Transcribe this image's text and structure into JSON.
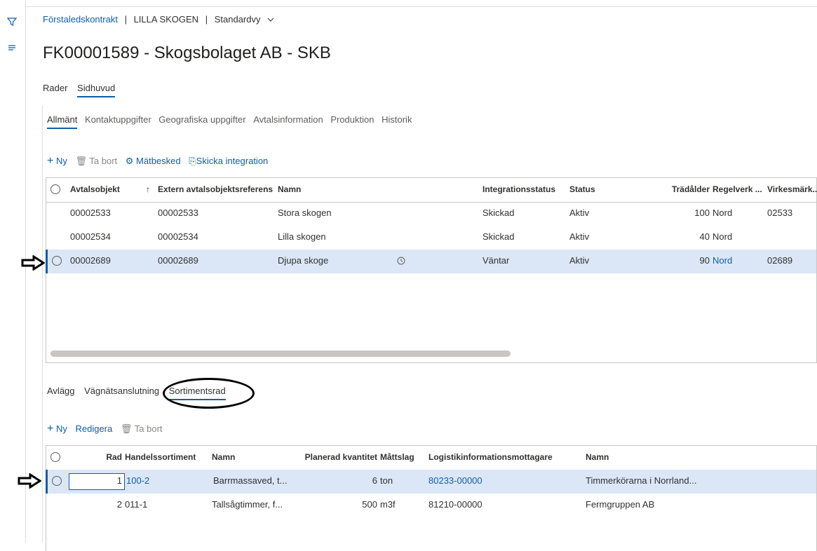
{
  "rail": {
    "filter_icon": "filter-icon",
    "menu_icon": "menu-icon"
  },
  "breadcrumb": {
    "crumb1": "Förstaledskontrakt",
    "sep1": "|",
    "crumb2": "LILLA SKOGEN",
    "sep2": "|",
    "view": "Standardvy",
    "view_icon": "chevron-down-icon"
  },
  "title": "FK00001589 - Skogsbolaget AB - SKB",
  "tabs": [
    "Rader",
    "Sidhuvud"
  ],
  "fasttabs": [
    "Allmänt",
    "Kontaktuppgifter",
    "Geografiska uppgifter",
    "Avtalsinformation",
    "Produktion",
    "Historik"
  ],
  "toolbar1": {
    "new": "Ny",
    "delete": "Ta bort",
    "measure": "Mätbesked",
    "send": "Skicka integration"
  },
  "grid1": {
    "headers": [
      "Avtalsobjekt",
      "Extern avtalsobjektsreferens",
      "Namn",
      "Integrationsstatus",
      "Status",
      "Trädålder",
      "Regelverk ...",
      "Virkesmärk..."
    ],
    "rows": [
      {
        "obj": "00002533",
        "ext": "00002533",
        "name": "Stora skogen",
        "integ": "Skickad",
        "status": "Aktiv",
        "age": "100",
        "rule": "Nord",
        "mark": "02533"
      },
      {
        "obj": "00002534",
        "ext": "00002534",
        "name": "Lilla skogen",
        "integ": "Skickad",
        "status": "Aktiv",
        "age": "40",
        "rule": "Nord",
        "mark": ""
      },
      {
        "obj": "00002689",
        "ext": "00002689",
        "name": "Djupa skoge",
        "integ": "Väntar",
        "status": "Aktiv",
        "age": "90",
        "rule": "Nord",
        "mark": "02689"
      }
    ]
  },
  "subtabs": [
    "Avlägg",
    "Vägnätsanslutning",
    "Sortimentsrad"
  ],
  "toolbar2": {
    "new": "Ny",
    "edit": "Redigera",
    "delete": "Ta bort"
  },
  "grid2": {
    "headers": [
      "Rad",
      "Handelssortiment",
      "Namn",
      "Planerad kvantitet",
      "Måttslag",
      "Logistikinformationsmottagare",
      "Namn"
    ],
    "rows": [
      {
        "rad": "1",
        "sort": "100-2",
        "name": "Barrmassaved, t...",
        "qty": "6",
        "unit": "ton",
        "recv": "80233-00000",
        "recvname": "Timmerkörarna i Norrland..."
      },
      {
        "rad": "2",
        "sort": "011-1",
        "name": "Tallsågtimmer, f...",
        "qty": "500",
        "unit": "m3f",
        "recv": "81210-00000",
        "recvname": "Fermgruppen AB"
      }
    ]
  },
  "colors": {
    "accent": "#0f5ea8",
    "selected_row": "#dbe6f6"
  }
}
